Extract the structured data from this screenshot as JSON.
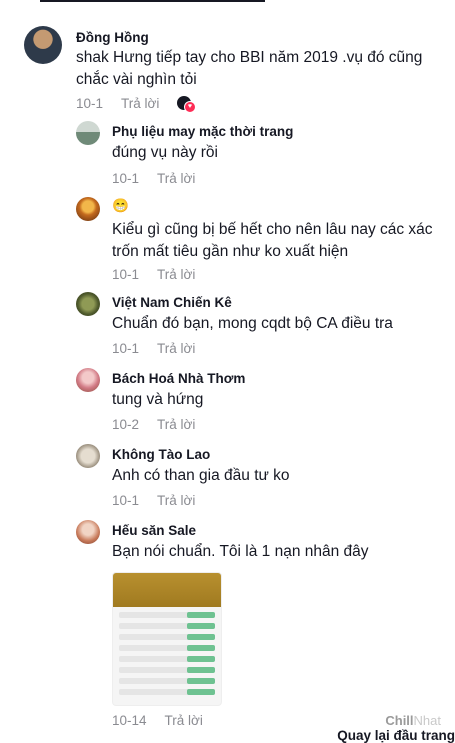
{
  "comments": [
    {
      "name": "Đồng Hồng",
      "text": "shak Hưng tiếp tay cho BBI năm 2019 .vụ đó cũng chắc vài nghìn tỏi",
      "date": "10-1",
      "reply": "Trả lời",
      "colors": [
        "#2e3a4a",
        "#c49a72"
      ]
    },
    {
      "name": "Phụ liệu may mặc thời trang",
      "text": "đúng vụ này rồi",
      "date": "10-1",
      "reply": "Trả lời",
      "colors": [
        "#6f8a78",
        "#cfd8d2"
      ]
    },
    {
      "name": "😁",
      "text": "Kiểu gì cũng bị bế hết cho nên lâu nay các xác trốn mất tiêu gần như ko xuất hiện",
      "date": "10-1",
      "reply": "Trả lời",
      "colors": [
        "#c46a1e",
        "#f2b64a"
      ]
    },
    {
      "name": "Việt Nam Chiến Kê",
      "text": "Chuẩn đó bạn, mong cqdt bộ CA điều tra",
      "date": "10-1",
      "reply": "Trả lời",
      "colors": [
        "#4f5a2c",
        "#8f9a55"
      ]
    },
    {
      "name": "Bách Hoá Nhà Thơm",
      "text": "tung và hứng",
      "date": "10-2",
      "reply": "Trả lời",
      "colors": [
        "#d27b86",
        "#f3c9c9"
      ]
    },
    {
      "name": "Không Tào Lao",
      "text": "Anh có than gia đầu tư ko",
      "date": "10-1",
      "reply": "Trả lời",
      "colors": [
        "#9a8f7e",
        "#e5ddd0"
      ]
    },
    {
      "name": "Hếu săn Sale",
      "text": "Bạn nói chuẩn. Tôi là 1 nạn nhân đây",
      "date": "10-14",
      "reply": "Trả lời",
      "colors": [
        "#c87a5a",
        "#f1d4c4"
      ]
    }
  ],
  "watermark": {
    "a": "Chill",
    "b": "Nhat"
  },
  "bottom_link": "Quay lại đầu trang"
}
